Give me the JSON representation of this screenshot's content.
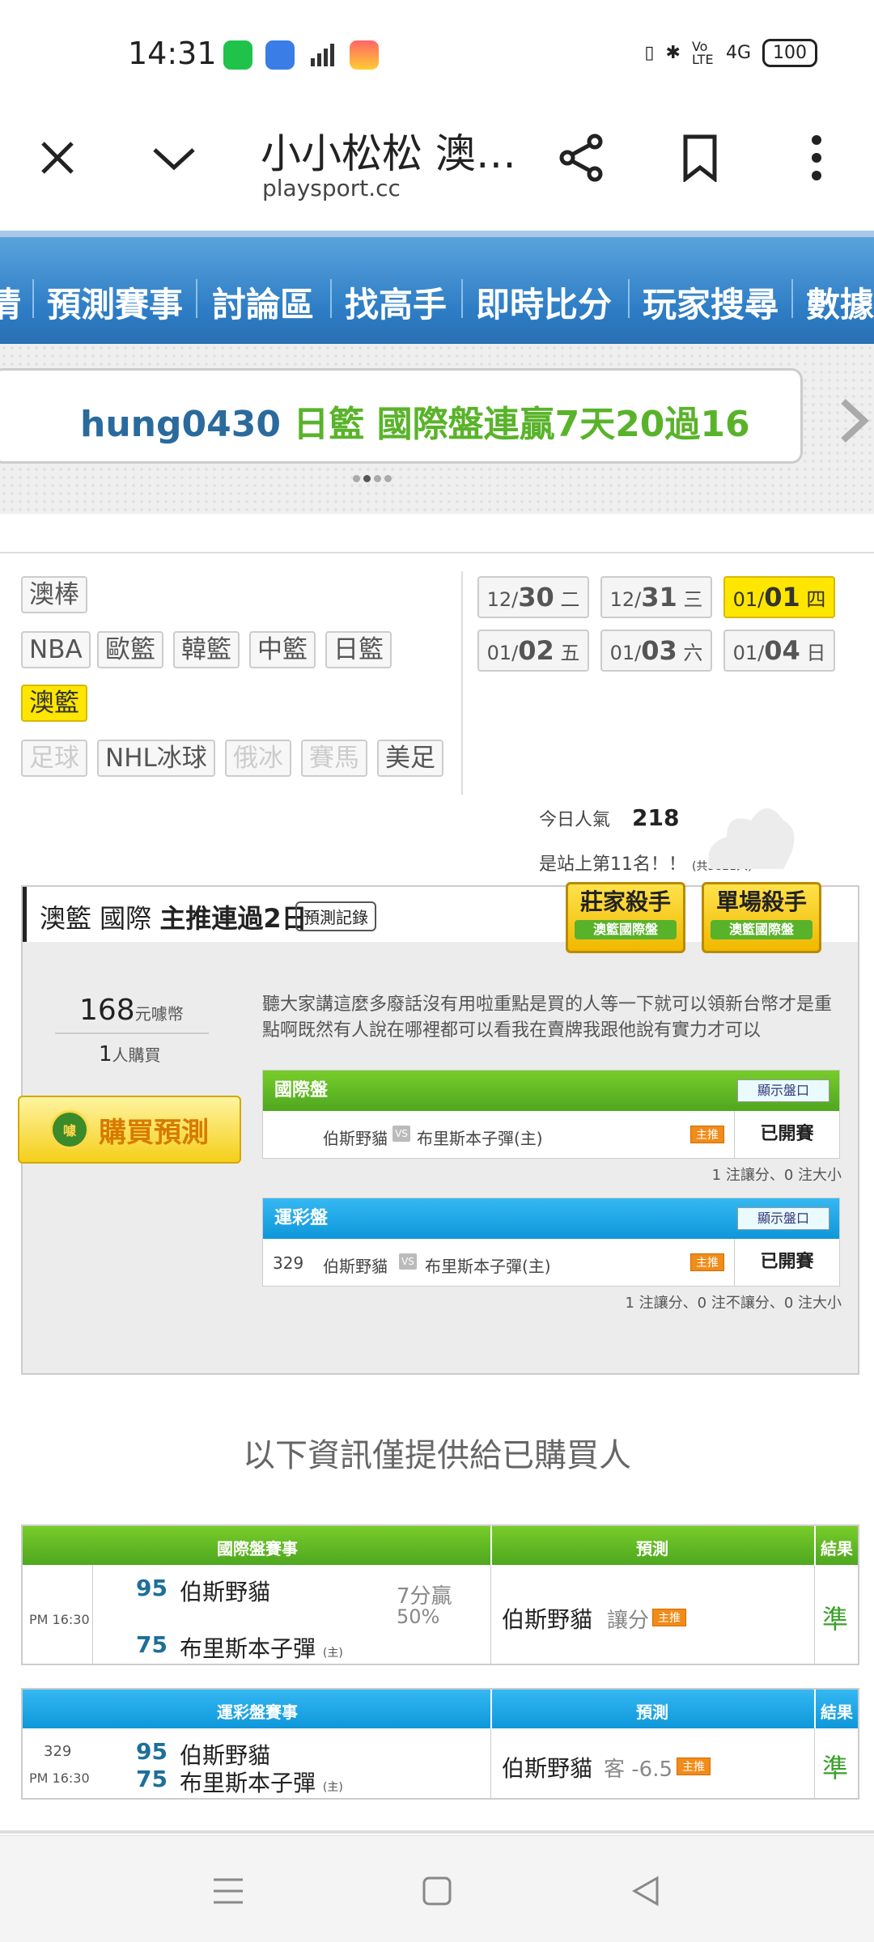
{
  "status_bar": {
    "time": "14:31",
    "network": "4G",
    "volte": "Vo LTE",
    "battery": "100"
  },
  "browser": {
    "title": "小小松松 澳…",
    "url": "playsport.cc"
  },
  "nav": {
    "items": [
      "情",
      "預測賽事",
      "討論區",
      "找高手",
      "即時比分",
      "玩家搜尋",
      "數據"
    ]
  },
  "banner": {
    "user": "hung0430",
    "text": " 日籃 國際盤連贏7天20過16"
  },
  "sports": {
    "row1": [
      "澳棒"
    ],
    "row2": [
      "NBA",
      "歐籃",
      "韓籃",
      "中籃",
      "日籃"
    ],
    "row3": [
      "澳籃"
    ],
    "row4": [
      "足球",
      "NHL冰球",
      "俄冰",
      "賽馬",
      "美足"
    ]
  },
  "dates": [
    {
      "md": "12/",
      "d": "30",
      "w": "二"
    },
    {
      "md": "12/",
      "d": "31",
      "w": "三"
    },
    {
      "md": "01/",
      "d": "01",
      "w": "四"
    },
    {
      "md": "01/",
      "d": "02",
      "w": "五"
    },
    {
      "md": "01/",
      "d": "03",
      "w": "六"
    },
    {
      "md": "01/",
      "d": "04",
      "w": "日"
    }
  ],
  "popularity": {
    "label": "今日人氣",
    "value": "218",
    "rank_text": "是站上第11名！！",
    "total": "(共3821人)"
  },
  "panel": {
    "league": "澳籃 國際 ",
    "streak": "主推連過2日",
    "record_btn": "預測記錄",
    "badge1": {
      "title": "莊家殺手",
      "sub": "澳籃國際盤"
    },
    "badge2": {
      "title": "單場殺手",
      "sub": "澳籃國際盤"
    },
    "price": "168",
    "price_unit": "元噱幣",
    "buyers": "1",
    "buyers_unit": "人購買",
    "buy_label": "購買預測",
    "coin_label": "噱",
    "description": "聽大家講這麼多廢話沒有用啦重點是買的人等一下就可以領新台幣才是重點啊既然有人說在哪裡都可以看我在賣牌我跟他說有實力才可以",
    "intl": {
      "header": "國際盤",
      "show_btn": "顯示盤口",
      "away": "伯斯野貓",
      "vs": "VS",
      "home": "布里斯本子彈(主)",
      "tag": "主推",
      "status": "已開賽",
      "note": "1 注讓分、0 注大小"
    },
    "lottery": {
      "header": "運彩盤",
      "show_btn": "顯示盤口",
      "code": "329",
      "away": "伯斯野貓",
      "vs": "VS",
      "home": "布里斯本子彈(主)",
      "tag": "主推",
      "status": "已開賽",
      "note": "1 注讓分、0 注不讓分、0 注大小"
    }
  },
  "info_title": "以下資訊僅提供給已購買人",
  "table1": {
    "headers": [
      "國際盤賽事",
      "預測",
      "結果"
    ],
    "time": "PM 16:30",
    "away_score": "95",
    "away": "伯斯野貓",
    "home_score": "75",
    "home": "布里斯本子彈",
    "home_mark": "(主)",
    "margin": "7分贏",
    "pct": "50%",
    "pick_team": "伯斯野貓",
    "pick_type": "讓分",
    "tag": "主推",
    "result": "準"
  },
  "table2": {
    "headers": [
      "運彩盤賽事",
      "預測",
      "結果"
    ],
    "code": "329",
    "time": "PM 16:30",
    "away_score": "95",
    "away": "伯斯野貓",
    "home_score": "75",
    "home": "布里斯本子彈",
    "home_mark": "(主)",
    "pick_team": "伯斯野貓",
    "pick_type": "客 -6.5",
    "tag": "主推",
    "result": "準"
  },
  "colors": {
    "green": "#5cb82a",
    "blue": "#1aa3e6",
    "nav_blue": "#2d7cc4",
    "yellow": "#ffe600"
  }
}
